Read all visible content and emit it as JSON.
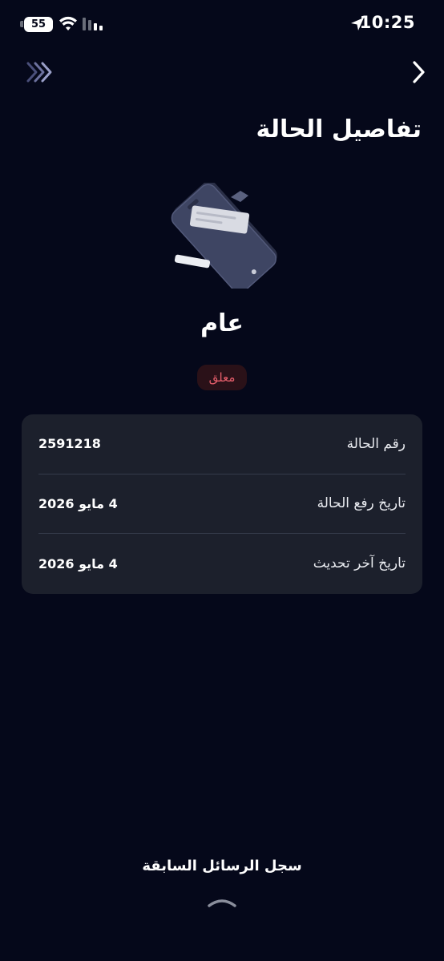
{
  "status_bar": {
    "battery": "55",
    "time": "10:25"
  },
  "header": {
    "title": "تفاصيل الحالة"
  },
  "case": {
    "category": "عام",
    "status": "معلق",
    "status_color": "#e35d6a"
  },
  "details": [
    {
      "label": "رقم الحالة",
      "value": "2591218"
    },
    {
      "label": "تاريخ رفع الحالة",
      "value": "4 مايو 2026"
    },
    {
      "label": "تاريخ آخر تحديث",
      "value": "4 مايو 2026"
    }
  ],
  "footer": {
    "history_label": "سجل الرسائل السابقة"
  },
  "icons": {
    "forward": "chevrons-forward-icon",
    "back": "chevron-right-icon",
    "expand": "chevron-up-icon"
  }
}
